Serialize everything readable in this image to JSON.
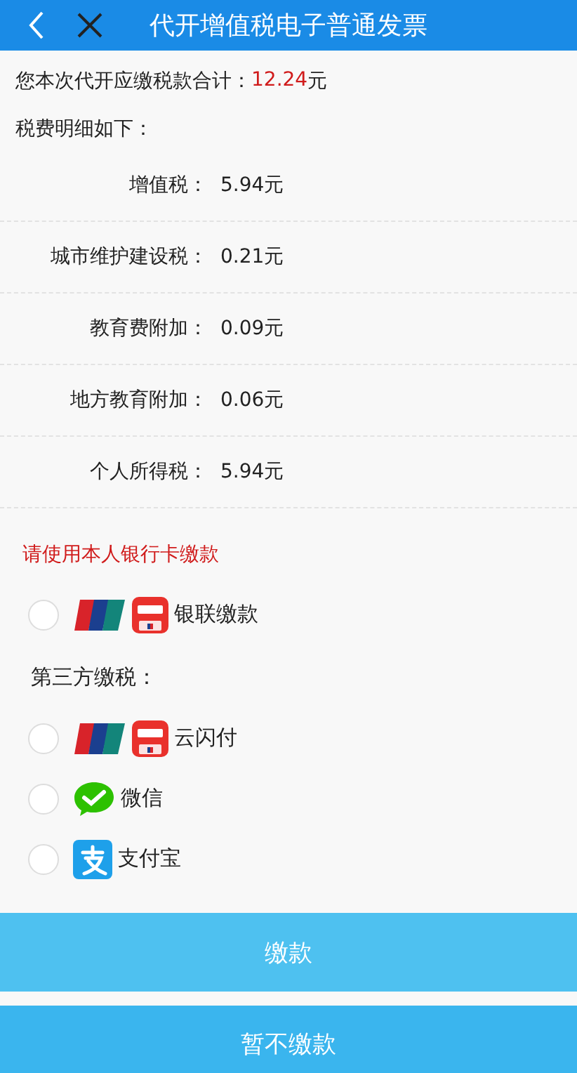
{
  "header": {
    "title": "代开增值税电子普通发票"
  },
  "total": {
    "label": "您本次代开应缴税款合计：",
    "amount": "12.24",
    "unit": "元"
  },
  "details_heading": "税费明细如下：",
  "details": [
    {
      "label": "增值税：",
      "value": "5.94元"
    },
    {
      "label": "城市维护建设税：",
      "value": "0.21元"
    },
    {
      "label": "教育费附加：",
      "value": "0.09元"
    },
    {
      "label": "地方教育附加：",
      "value": "0.06元"
    },
    {
      "label": "个人所得税：",
      "value": "5.94元"
    }
  ],
  "bank_notice": "请使用本人银行卡缴款",
  "bank_options": [
    {
      "kind": "unionpay",
      "label": "银联缴款",
      "selected": false
    }
  ],
  "third_party_heading": "第三方缴税：",
  "third_party_options": [
    {
      "kind": "unionpay",
      "label": "云闪付",
      "selected": false
    },
    {
      "kind": "wechat",
      "label": "微信",
      "selected": false
    },
    {
      "kind": "alipay",
      "label": "支付宝",
      "selected": false
    }
  ],
  "buttons": [
    {
      "label": "缴款"
    },
    {
      "label": "暂不缴款"
    }
  ]
}
